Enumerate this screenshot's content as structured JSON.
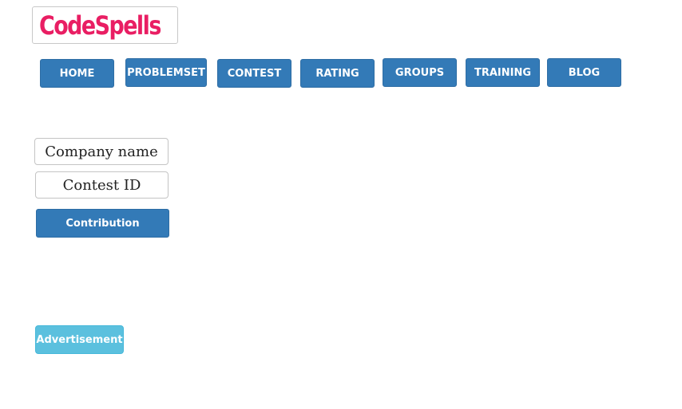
{
  "brand": {
    "logo_text": "CodeSpells",
    "color": "#e91e63"
  },
  "nav": {
    "items": [
      {
        "label": "HOME"
      },
      {
        "label": "PROBLEMSET"
      },
      {
        "label": "CONTEST"
      },
      {
        "label": "RATING"
      },
      {
        "label": "GROUPS"
      },
      {
        "label": "TRAINING"
      },
      {
        "label": "BLOG"
      }
    ],
    "color": "#337ab7"
  },
  "form": {
    "company_name": "Company name",
    "contest_id": "Contest ID",
    "submit_label": "Contribution"
  },
  "advertisement": {
    "label": "Advertisement",
    "color": "#5bc0de"
  }
}
